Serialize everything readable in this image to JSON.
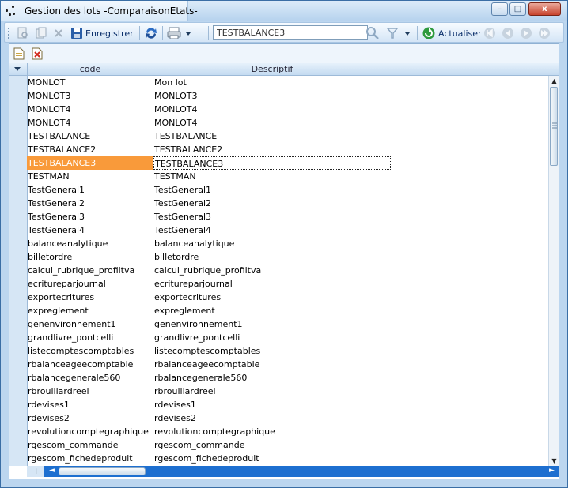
{
  "window": {
    "title": "Gestion des lots -ComparaisonEtats-",
    "controls": {
      "minimize": "–",
      "maximize": "□",
      "close": "x"
    }
  },
  "toolbar": {
    "save_label": "Enregistrer",
    "search_value": "TESTBALANCE3",
    "refresh_label": "Actualiser"
  },
  "grid": {
    "columns": [
      "code",
      "Descriptif"
    ],
    "selected_index": 7,
    "rows": [
      {
        "code": "MONLOT",
        "desc": "Mon lot"
      },
      {
        "code": "MONLOT3",
        "desc": "MONLOT3"
      },
      {
        "code": "MONLOT4",
        "desc": "MONLOT4"
      },
      {
        "code": "MONLOT4",
        "desc": "MONLOT4"
      },
      {
        "code": "TESTBALANCE",
        "desc": "TESTBALANCE"
      },
      {
        "code": "TESTBALANCE2",
        "desc": "TESTBALANCE2"
      },
      {
        "code": "TESTBALANCE3",
        "desc": "TESTBALANCE3"
      },
      {
        "code": "TESTMAN",
        "desc": "TESTMAN"
      },
      {
        "code": "TestGeneral1",
        "desc": "TestGeneral1"
      },
      {
        "code": "TestGeneral2",
        "desc": "TestGeneral2"
      },
      {
        "code": "TestGeneral3",
        "desc": "TestGeneral3"
      },
      {
        "code": "TestGeneral4",
        "desc": "TestGeneral4"
      },
      {
        "code": "balanceanalytique",
        "desc": "balanceanalytique"
      },
      {
        "code": "billetordre",
        "desc": "billetordre"
      },
      {
        "code": "calcul_rubrique_profiltva",
        "desc": "calcul_rubrique_profiltva"
      },
      {
        "code": "ecritureparjournal",
        "desc": "ecritureparjournal"
      },
      {
        "code": "exportecritures",
        "desc": "exportecritures"
      },
      {
        "code": "expreglement",
        "desc": "expreglement"
      },
      {
        "code": "genenvironnement1",
        "desc": "genenvironnement1"
      },
      {
        "code": "grandlivre_pontcelli",
        "desc": "grandlivre_pontcelli"
      },
      {
        "code": "listecomptescomptables",
        "desc": "listecomptescomptables"
      },
      {
        "code": "rbalanceageecomptable",
        "desc": "rbalanceageecomptable"
      },
      {
        "code": "rbalancegenerale560",
        "desc": "rbalancegenerale560"
      },
      {
        "code": "rbrouillardreel",
        "desc": "rbrouillardreel"
      },
      {
        "code": "rdevises1",
        "desc": "rdevises1"
      },
      {
        "code": "rdevises2",
        "desc": "rdevises2"
      },
      {
        "code": "revolutioncomptegraphique",
        "desc": "revolutioncomptegraphique"
      },
      {
        "code": "rgescom_commande",
        "desc": "rgescom_commande"
      },
      {
        "code": "rgescom_fichedeproduit",
        "desc": "rgescom_fichedeproduit"
      }
    ]
  },
  "colors": {
    "selection": "#f99a3a",
    "scrollbar": "#1d6fd0",
    "header": "#c4dbf1"
  }
}
